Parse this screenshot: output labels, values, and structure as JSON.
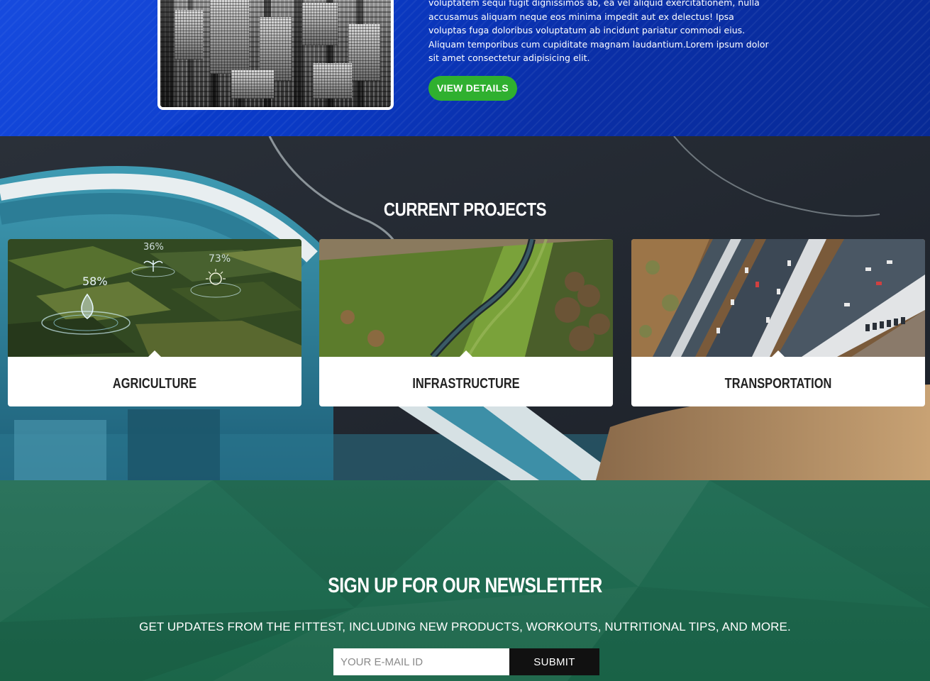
{
  "about": {
    "text": "voluptatem sequi fugit dignissimos ab, ea vel aliquid exercitationem, nulla accusamus aliquam neque eos minima impedit aut ex delectus! Ipsa voluptas fuga doloribus voluptatum ab incidunt pariatur commodi eius. Aliquam temporibus cum cupiditate magnam laudantium.Lorem ipsum dolor sit amet consectetur adipisicing elit.",
    "button_label": "VIEW DETAILS"
  },
  "projects": {
    "title": "CURRENT PROJECTS",
    "cards": [
      {
        "label": "AGRICULTURE",
        "overlay": [
          "58%",
          "36%",
          "73%"
        ]
      },
      {
        "label": "INFRASTRUCTURE"
      },
      {
        "label": "TRANSPORTATION"
      }
    ]
  },
  "newsletter": {
    "title": "SIGN UP FOR OUR NEWSLETTER",
    "subtitle": "GET UPDATES FROM THE FITTEST, INCLUDING NEW PRODUCTS, WORKOUTS, NUTRITIONAL TIPS, AND MORE.",
    "input_placeholder": "YOUR E-MAIL ID",
    "submit_label": "SUBMIT"
  },
  "colors": {
    "about_bg": "#0a3ac6",
    "button_green": "#2fb02f",
    "newsletter_bg": "#1f6a50",
    "submit_bg": "#111111"
  }
}
